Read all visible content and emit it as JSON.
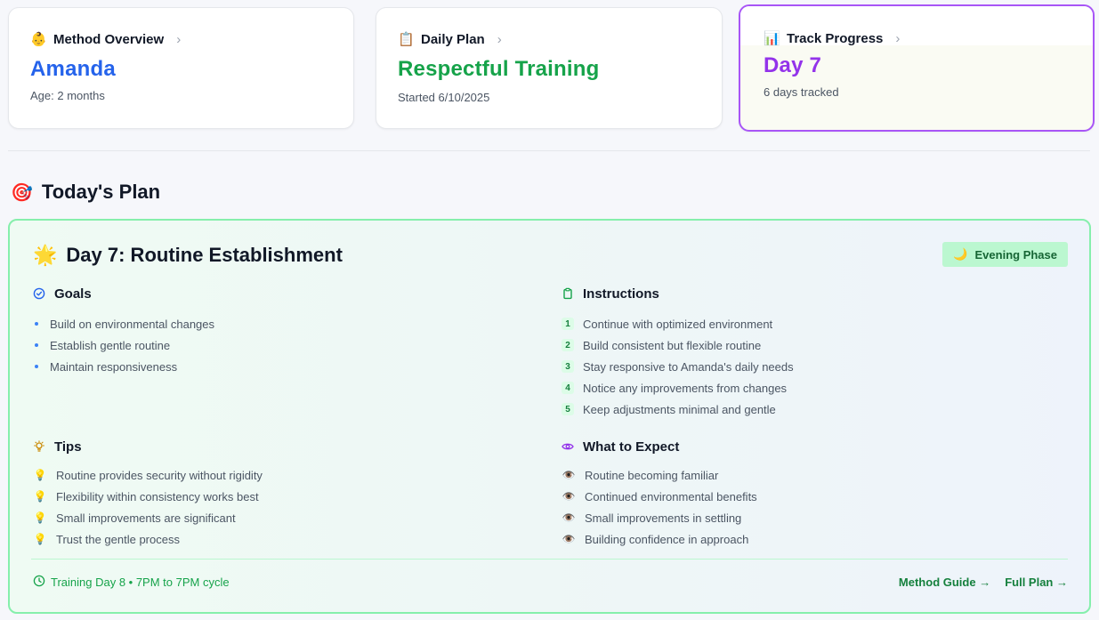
{
  "cards": {
    "method": {
      "emoji": "👶",
      "label": "Method Overview",
      "value": "Amanda",
      "sub": "Age: 2 months",
      "color": "#2563eb"
    },
    "daily": {
      "emoji": "📋",
      "label": "Daily Plan",
      "value": "Respectful Training",
      "sub": "Started 6/10/2025",
      "color": "#16a34a"
    },
    "progress": {
      "emoji": "📊",
      "label": "Track Progress",
      "value": "Day 7",
      "sub": "6 days tracked",
      "color": "#9333ea"
    }
  },
  "section": {
    "emoji": "🎯",
    "title": "Today's Plan"
  },
  "plan": {
    "emoji": "🌟",
    "title": "Day 7: Routine Establishment",
    "phase_emoji": "🌙",
    "phase": "Evening Phase",
    "goals": {
      "title": "Goals",
      "items": [
        "Build on environmental changes",
        "Establish gentle routine",
        "Maintain responsiveness"
      ]
    },
    "instructions": {
      "title": "Instructions",
      "items": [
        {
          "num": "1",
          "text": "Continue with optimized environment"
        },
        {
          "num": "2",
          "text": "Build consistent but flexible routine"
        },
        {
          "num": "3",
          "text": "Stay responsive to Amanda's daily needs"
        },
        {
          "num": "4",
          "text": "Notice any improvements from changes"
        },
        {
          "num": "5",
          "text": "Keep adjustments minimal and gentle"
        }
      ]
    },
    "tips": {
      "title": "Tips",
      "emoji": "💡",
      "items": [
        "Routine provides security without rigidity",
        "Flexibility within consistency works best",
        "Small improvements are significant",
        "Trust the gentle process"
      ]
    },
    "expect": {
      "title": "What to Expect",
      "emoji": "👁️",
      "items": [
        "Routine becoming familiar",
        "Continued environmental benefits",
        "Small improvements in settling",
        "Building confidence in approach"
      ]
    },
    "footer": {
      "info": "Training Day 8 • 7PM to 7PM cycle",
      "link_method": "Method Guide →",
      "link_full": "Full Plan →"
    }
  },
  "colors": {
    "accent_green": "#16a34a",
    "accent_blue": "#2563eb",
    "accent_purple": "#9333ea"
  }
}
